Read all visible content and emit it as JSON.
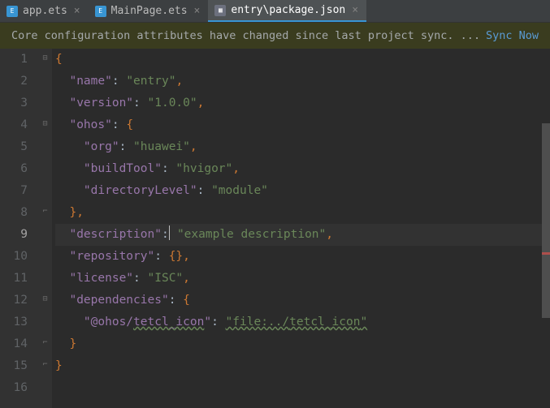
{
  "tabs": [
    {
      "label": "app.ets",
      "icon": "ets"
    },
    {
      "label": "MainPage.ets",
      "icon": "ets"
    },
    {
      "label": "entry\\package.json",
      "icon": "json"
    }
  ],
  "active_tab": 2,
  "notice": {
    "message": "Core configuration attributes have changed since last project sync. ...",
    "action": "Sync Now"
  },
  "inspection": {
    "error_count": "1",
    "warn_count": "1"
  },
  "lines": [
    "1",
    "2",
    "3",
    "4",
    "5",
    "6",
    "7",
    "8",
    "9",
    "10",
    "11",
    "12",
    "13",
    "14",
    "15",
    "16"
  ],
  "current_line_index": 8,
  "code": {
    "name_k": "\"name\"",
    "name_v": "\"entry\"",
    "version_k": "\"version\"",
    "version_v": "\"1.0.0\"",
    "ohos_k": "\"ohos\"",
    "org_k": "\"org\"",
    "org_v": "\"huawei\"",
    "buildTool_k": "\"buildTool\"",
    "buildTool_v": "\"hvigor\"",
    "dirLevel_k": "\"directoryLevel\"",
    "dirLevel_v": "\"module\"",
    "desc_k": "\"description\"",
    "desc_v": "\"example description\"",
    "repo_k": "\"repository\"",
    "license_k": "\"license\"",
    "license_v": "\"ISC\"",
    "deps_k": "\"dependencies\"",
    "dep1_k": "\"@ohos/",
    "dep1_k2": "tetcl_icon",
    "dep1_k3": "\"",
    "dep1_v1": "\"file:../",
    "dep1_v2": "tetcl_icon",
    "dep1_v3": "\"",
    "brace_o": "{",
    "brace_c": "}",
    "brace_e": "{}",
    "comma": ",",
    "colon": ":",
    "colon_sp": ": "
  }
}
